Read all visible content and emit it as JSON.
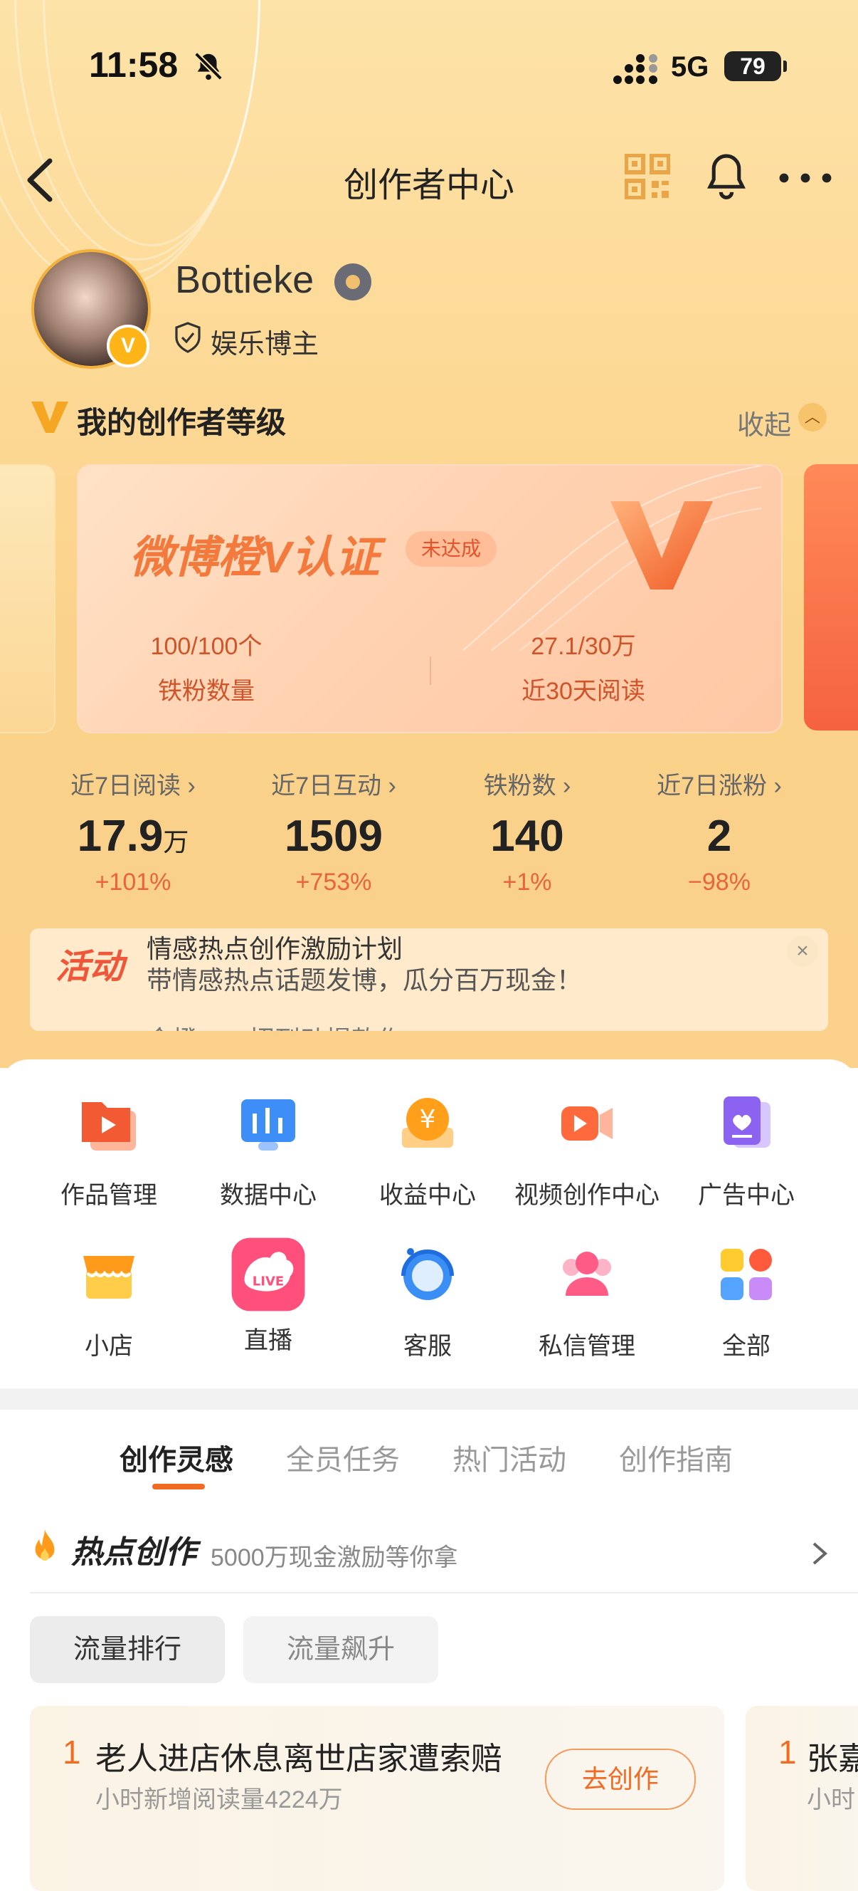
{
  "status_bar": {
    "time": "11:58",
    "network": "5G",
    "battery": "79"
  },
  "nav": {
    "title": "创作者中心"
  },
  "profile": {
    "username": "Bottieke",
    "verified_mark": "V",
    "role": "娱乐博主"
  },
  "level": {
    "title": "我的创作者等级",
    "collapse_label": "收起",
    "card": {
      "title": "微博橙V认证",
      "badge": "未达成",
      "stats": [
        {
          "value": "100/100个",
          "label": "铁粉数量"
        },
        {
          "value": "27.1/30万",
          "label": "近30天阅读"
        }
      ]
    }
  },
  "stats": [
    {
      "label": "近7日阅读",
      "value": "17.9",
      "unit": "万",
      "change": "+101%"
    },
    {
      "label": "近7日互动",
      "value": "1509",
      "unit": "",
      "change": "+753%"
    },
    {
      "label": "铁粉数",
      "value": "140",
      "unit": "",
      "change": "+1%"
    },
    {
      "label": "近7日涨粉",
      "value": "2",
      "unit": "",
      "change": "−98%"
    }
  ],
  "activity": {
    "tag": "活动",
    "title": "情感热点创作激励计划",
    "subtitle": "带情感热点话题发博，瓜分百万现金！",
    "next_line": "金橙，一招到动提款作"
  },
  "tools": [
    {
      "label": "作品管理",
      "icon": "works-folder-icon"
    },
    {
      "label": "数据中心",
      "icon": "data-chart-icon"
    },
    {
      "label": "收益中心",
      "icon": "income-coin-icon"
    },
    {
      "label": "视频创作中心",
      "icon": "video-camera-icon"
    },
    {
      "label": "广告中心",
      "icon": "ad-card-icon"
    },
    {
      "label": "小店",
      "icon": "shop-icon"
    },
    {
      "label": "直播",
      "icon": "live-icon"
    },
    {
      "label": "客服",
      "icon": "customer-service-icon"
    },
    {
      "label": "私信管理",
      "icon": "messages-icon"
    },
    {
      "label": "全部",
      "icon": "all-apps-icon"
    }
  ],
  "tabs": [
    {
      "label": "创作灵感",
      "active": true
    },
    {
      "label": "全员任务",
      "active": false
    },
    {
      "label": "热门活动",
      "active": false
    },
    {
      "label": "创作指南",
      "active": false
    }
  ],
  "hot": {
    "title": "热点创作",
    "subtitle": "5000万现金激励等你拿"
  },
  "chips": [
    {
      "label": "流量排行",
      "active": true
    },
    {
      "label": "流量飙升",
      "active": false
    }
  ],
  "items": [
    {
      "rank": "1",
      "title": "老人进店休息离世店家遭索赔",
      "sub": "小时新增阅读量4224万",
      "button": "去创作"
    },
    {
      "rank": "1",
      "title": "张嘉",
      "sub": "小时"
    }
  ],
  "colors": {
    "accent": "#f26b22",
    "brand_orange": "#f37a3c"
  }
}
